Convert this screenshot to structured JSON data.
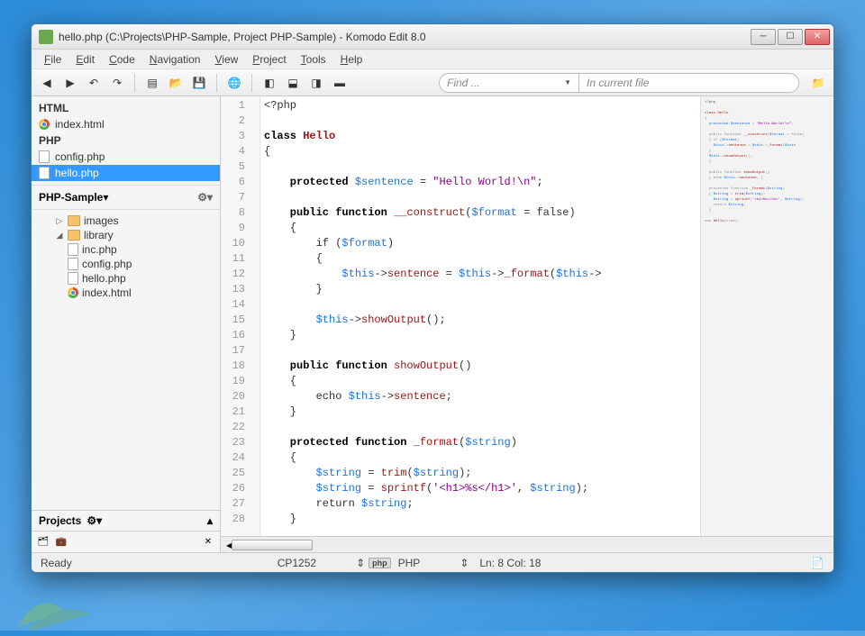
{
  "window": {
    "title": "hello.php (C:\\Projects\\PHP-Sample, Project PHP-Sample) - Komodo Edit 8.0"
  },
  "menu": {
    "file": "File",
    "edit": "Edit",
    "code": "Code",
    "navigation": "Navigation",
    "view": "View",
    "project": "Project",
    "tools": "Tools",
    "help": "Help"
  },
  "toolbar": {
    "find_placeholder": "Find ...",
    "scope_placeholder": "In current file"
  },
  "openfiles": {
    "group_html": "HTML",
    "html_file": "index.html",
    "group_php": "PHP",
    "php_file1": "config.php",
    "php_file2": "hello.php"
  },
  "project": {
    "name": "PHP-Sample",
    "items": {
      "images": "images",
      "library": "library",
      "inc": "inc.php",
      "config": "config.php",
      "hello": "hello.php",
      "index": "index.html"
    },
    "footer": "Projects"
  },
  "code": {
    "l1": "<?php",
    "l2": "",
    "l3a": "class ",
    "l3b": "Hello",
    "l4": "{",
    "l5": "",
    "l6a": "    protected ",
    "l6b": "$sentence",
    "l6c": " = ",
    "l6d": "\"Hello World!\\n\"",
    "l6e": ";",
    "l7": "",
    "l8a": "    public function ",
    "l8b": "__construct",
    "l8c": "(",
    "l8d": "$format",
    "l8e": " = false)",
    "l9": "    {",
    "l10a": "        if (",
    "l10b": "$format",
    "l10c": ")",
    "l11": "        {",
    "l12a": "            ",
    "l12b": "$this",
    "l12c": "->",
    "l12d": "sentence",
    "l12e": " = ",
    "l12f": "$this",
    "l12g": "->",
    "l12h": "_format",
    "l12i": "(",
    "l12j": "$this",
    "l12k": "->",
    "l13": "        }",
    "l14": "",
    "l15a": "        ",
    "l15b": "$this",
    "l15c": "->",
    "l15d": "showOutput",
    "l15e": "();",
    "l16": "    }",
    "l17": "",
    "l18a": "    public function ",
    "l18b": "showOutput",
    "l18c": "()",
    "l19": "    {",
    "l20a": "        echo ",
    "l20b": "$this",
    "l20c": "->",
    "l20d": "sentence",
    "l20e": ";",
    "l21": "    }",
    "l22": "",
    "l23a": "    protected function ",
    "l23b": "_format",
    "l23c": "(",
    "l23d": "$string",
    "l23e": ")",
    "l24": "    {",
    "l25a": "        ",
    "l25b": "$string",
    "l25c": " = ",
    "l25d": "trim",
    "l25e": "(",
    "l25f": "$string",
    "l25g": ");",
    "l26a": "        ",
    "l26b": "$string",
    "l26c": " = ",
    "l26d": "sprintf",
    "l26e": "(",
    "l26f": "'<h1>%s</h1>'",
    "l26g": ", ",
    "l26h": "$string",
    "l26i": ");",
    "l27a": "        return ",
    "l27b": "$string",
    "l27c": ";",
    "l28": "    }"
  },
  "line_numbers": [
    "1",
    "2",
    "3",
    "4",
    "5",
    "6",
    "7",
    "8",
    "9",
    "10",
    "11",
    "12",
    "13",
    "14",
    "15",
    "16",
    "17",
    "18",
    "19",
    "20",
    "21",
    "22",
    "23",
    "24",
    "25",
    "26",
    "27",
    "28"
  ],
  "status": {
    "ready": "Ready",
    "encoding": "CP1252",
    "lang": "PHP",
    "lang_badge": "php",
    "pos": "Ln: 8 Col: 18"
  }
}
